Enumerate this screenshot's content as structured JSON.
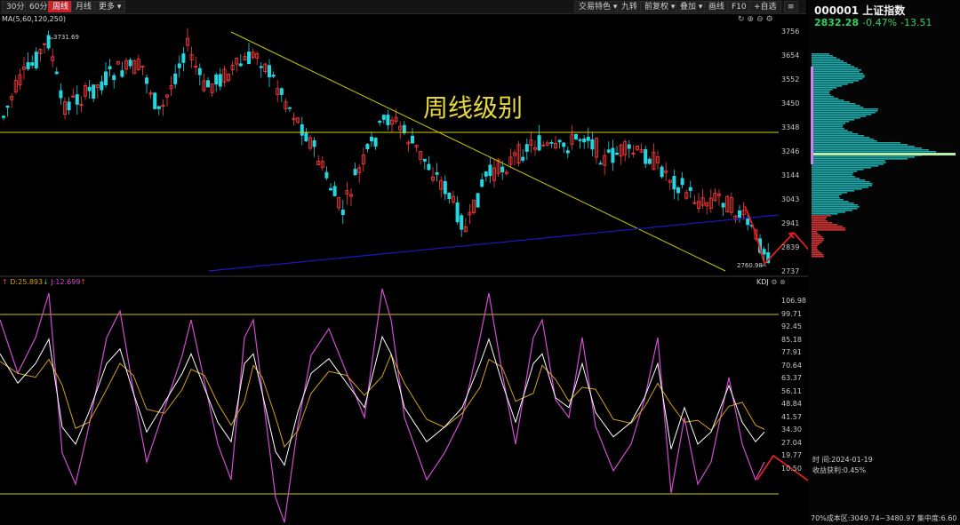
{
  "toolbar": {
    "periods": [
      "30分",
      "60分",
      "周线",
      "月线",
      "更多"
    ],
    "active_period": "周线",
    "right_items": [
      "交易特色",
      "九转",
      "前复权",
      "叠加",
      "画线",
      "F10",
      "自选"
    ]
  },
  "indicator_main": "MA(5,60,120,250)",
  "annotations": {
    "title": "周线级别",
    "peak_label": "3731.69",
    "low_label": "2760.98"
  },
  "price_axis": [
    "3756",
    "3654",
    "3552",
    "3450",
    "3348",
    "3246",
    "3144",
    "3043",
    "2941",
    "2839",
    "2737"
  ],
  "kdj": {
    "title": "KDJ",
    "d_label": "D:25.893",
    "j_label": "J:12.699",
    "axis": [
      "106.98",
      "99.71",
      "92.45",
      "85.18",
      "77.91",
      "70.64",
      "63.37",
      "56.11",
      "48.84",
      "41.57",
      "34.30",
      "27.04",
      "19.77",
      "10.50"
    ]
  },
  "stock": {
    "code": "000001",
    "name": "上证指数",
    "price": "2832.28",
    "change_pct": "-0.47%",
    "change": "-13.51"
  },
  "info_panel": {
    "time_label": "时",
    "time_value": "间:2024-01-19",
    "profit": "收益获利:0.45%",
    "range": "70%成本区:3049.74~3480.97",
    "concentration": "集中度:6.60"
  },
  "chart_data": {
    "type": "candlestick",
    "period": "weekly",
    "price_range": [
      2737,
      3756
    ],
    "highlights": {
      "high": 3731.69,
      "low": 2760.98
    },
    "kdj_range": [
      0,
      110
    ],
    "kdj_reference_lines": [
      0,
      99.71
    ],
    "series": [
      {
        "name": "K",
        "color": "#ffffff"
      },
      {
        "name": "D",
        "color": "#d4a017"
      },
      {
        "name": "J",
        "color": "#d24cd2"
      }
    ]
  },
  "colors": {
    "up": "#ff3b3b",
    "down": "#24d6e0",
    "support": "#d4d000",
    "trend": "#1818c8",
    "accent": "#c8232c"
  }
}
